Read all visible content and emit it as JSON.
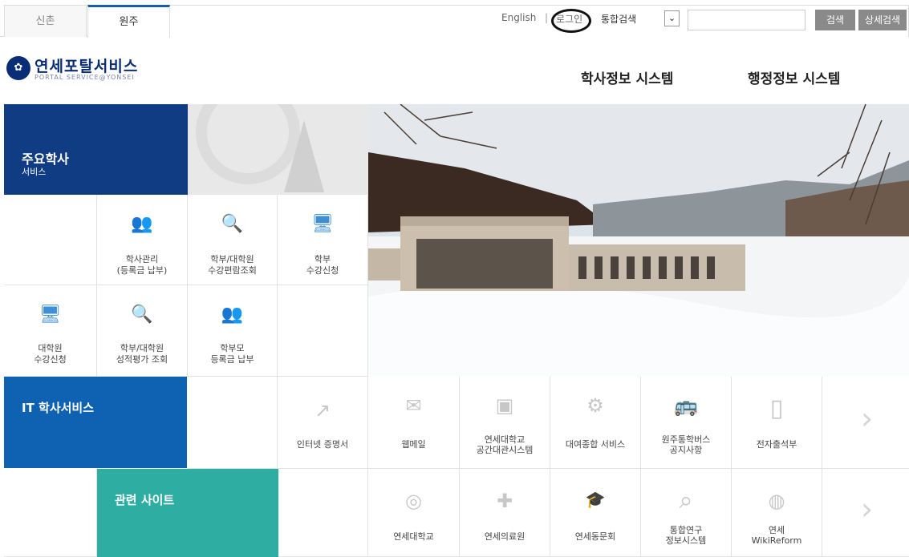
{
  "tabs": [
    {
      "label": "신촌"
    },
    {
      "label": "원주"
    }
  ],
  "util": {
    "english": "English",
    "separator": "|",
    "login": "로그인",
    "search_scope": "통합검색",
    "select_icon": "chevron-down-icon",
    "search_button": "검색",
    "advanced_button": "상세검색"
  },
  "logo": {
    "emblem": "✿",
    "title": "연세포탈서비스",
    "subtitle": "PORTAL SERVICE@YONSEI"
  },
  "nav": {
    "academic": "학사정보 시스템",
    "admin": "행정정보 시스템"
  },
  "academic": {
    "title": "주요학사",
    "subtitle": "서비스",
    "items": [
      {
        "icon": "user-database-icon",
        "glyph": "👥",
        "line1": "학사관리",
        "line2": "(등록금 납부)"
      },
      {
        "icon": "book-search-icon",
        "glyph": "🔍",
        "line1": "학부/대학원",
        "line2": "수강편람조회"
      },
      {
        "icon": "monitor-check-icon",
        "glyph": "🖥",
        "line1": "학부",
        "line2": "수강신청"
      },
      {
        "icon": "monitor-check-icon",
        "glyph": "🖥",
        "line1": "대학원",
        "line2": "수강신청"
      },
      {
        "icon": "document-search-icon",
        "glyph": "🔍",
        "line1": "학부/대학원",
        "line2": "성적평가 조회"
      },
      {
        "icon": "user-database-icon",
        "glyph": "👥",
        "line1": "학부모",
        "line2": "등록금 납부"
      }
    ]
  },
  "slider": {
    "prev": "‹",
    "pause": "❚❚",
    "next": "›"
  },
  "it": {
    "title": "IT 학사서비스",
    "items": [
      {
        "icon": "share-icon",
        "glyph": "↗",
        "line1": "인터넷 증명서",
        "line2": ""
      },
      {
        "icon": "mail-icon",
        "glyph": "✉",
        "line1": "웹메일",
        "line2": ""
      },
      {
        "icon": "building-icon",
        "glyph": "▣",
        "line1": "연세대학교",
        "line2": "공간대관시스템"
      },
      {
        "icon": "gears-icon",
        "glyph": "⚙",
        "line1": "대여종합 서비스",
        "line2": ""
      },
      {
        "icon": "bus-icon",
        "glyph": "🚌",
        "line1": "원주통학버스",
        "line2": "공지사항"
      },
      {
        "icon": "mobile-icon",
        "glyph": "▯",
        "line1": "전자출석부",
        "line2": ""
      }
    ],
    "more": "›"
  },
  "related": {
    "title": "관련 사이트",
    "items": [
      {
        "icon": "yonsei-emblem-icon",
        "glyph": "◎",
        "line1": "연세대학교",
        "line2": ""
      },
      {
        "icon": "medical-kit-icon",
        "glyph": "✚",
        "line1": "연세의료원",
        "line2": ""
      },
      {
        "icon": "graduation-cap-icon",
        "glyph": "🎓",
        "line1": "연세동문회",
        "line2": ""
      },
      {
        "icon": "map-search-icon",
        "glyph": "⌕",
        "line1": "통합연구",
        "line2": "정보시스템"
      },
      {
        "icon": "globe-icon",
        "glyph": "◍",
        "line1": "연세",
        "line2": "WikiReform"
      }
    ],
    "more": "›"
  }
}
